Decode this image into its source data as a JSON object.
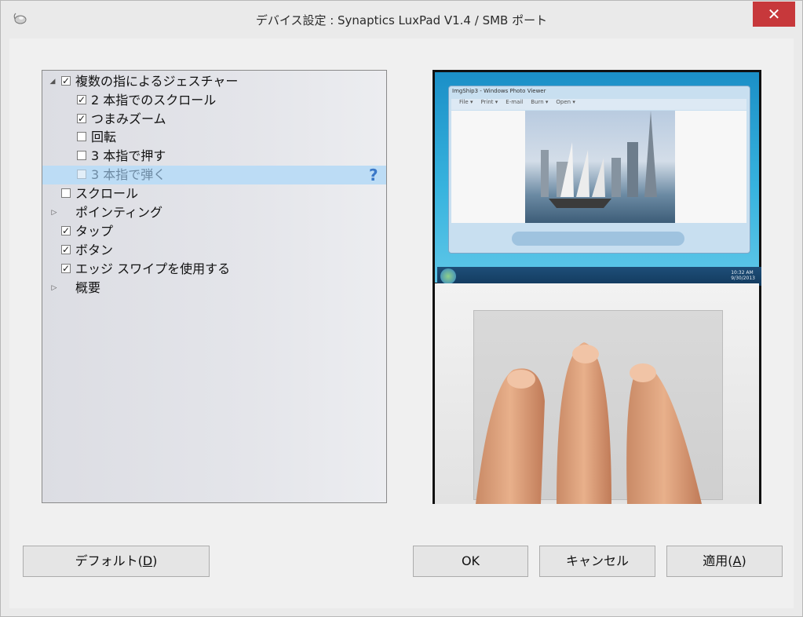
{
  "window": {
    "title": "デバイス設定 : Synaptics LuxPad V1.4 / SMB ポート",
    "close_glyph": "✕"
  },
  "tree": {
    "items": [
      {
        "label": "複数の指によるジェスチャー",
        "checked": true,
        "expander": "◢"
      },
      {
        "label": "2 本指でのスクロール",
        "checked": true
      },
      {
        "label": "つまみズーム",
        "checked": true
      },
      {
        "label": "回転",
        "checked": false
      },
      {
        "label": "3 本指で押す",
        "checked": false
      },
      {
        "label": "3 本指で弾く",
        "checked": false,
        "selected": true,
        "help": "?"
      },
      {
        "label": "スクロール",
        "checked": false
      },
      {
        "label": "ポインティング",
        "expander": "▷"
      },
      {
        "label": "タップ",
        "checked": true
      },
      {
        "label": "ボタン",
        "checked": true
      },
      {
        "label": "エッジ スワイプを使用する",
        "checked": true
      },
      {
        "label": "概要",
        "expander": "▷"
      }
    ]
  },
  "preview": {
    "window_title": "ImgShip3 - Windows Photo Viewer",
    "menu": [
      "File ▾",
      "Print ▾",
      "E-mail",
      "Burn ▾",
      "Open ▾"
    ],
    "clock": "10:32 AM\n9/30/2013"
  },
  "buttons": {
    "default": {
      "text": "デフォルト(",
      "mnemonic": "D",
      "end": ")"
    },
    "ok": "OK",
    "cancel": "キャンセル",
    "apply": {
      "text": "適用(",
      "mnemonic": "A",
      "end": ")"
    }
  },
  "icons": {
    "app": "mouse-icon",
    "close": "close-icon",
    "help": "help-icon",
    "check": "✓"
  },
  "colors": {
    "close_bg": "#c7383b",
    "selection": "#bcdcf5",
    "help": "#3a78c8"
  }
}
